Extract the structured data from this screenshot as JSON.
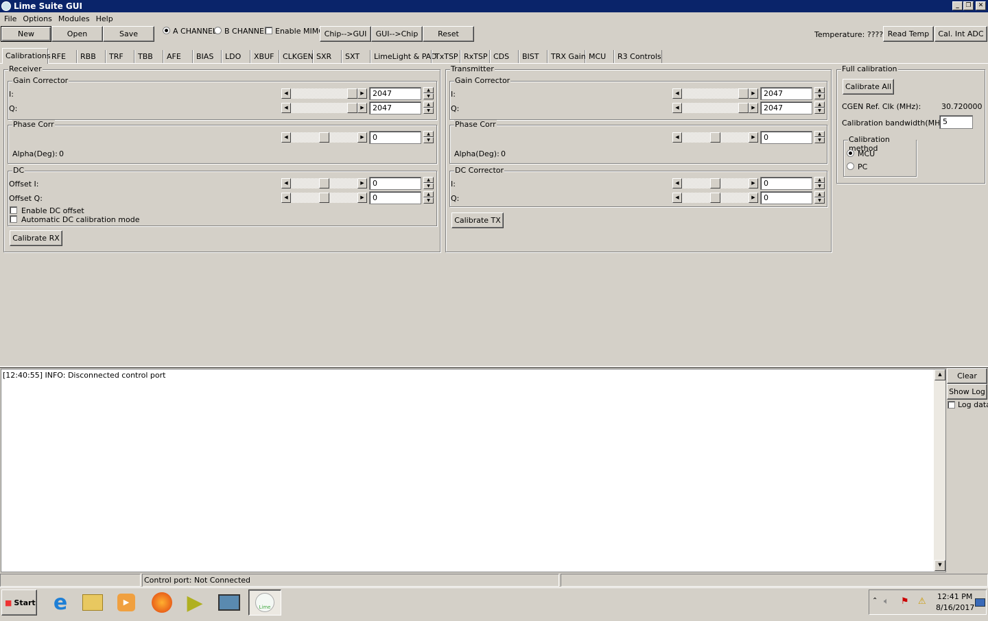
{
  "window": {
    "title": "Lime Suite GUI",
    "min": "_",
    "restore": "❐",
    "close": "✕"
  },
  "menu": [
    "File",
    "Options",
    "Modules",
    "Help"
  ],
  "toolbar": {
    "new": "New",
    "open": "Open",
    "save": "Save",
    "a_channel": "A CHANNEL",
    "b_channel": "B CHANNEL",
    "enable_mimo": "Enable MIMO",
    "chip_to_gui": "Chip-->GUI",
    "gui_to_chip": "GUI-->Chip",
    "reset": "Reset",
    "temperature": "Temperature: ?????",
    "read_temp": "Read Temp",
    "cal_int_adc": "Cal. Int ADC",
    "selected_channel": "A"
  },
  "tabs": [
    "Calibrations",
    "RFE",
    "RBB",
    "TRF",
    "TBB",
    "AFE",
    "BIAS",
    "LDO",
    "XBUF",
    "CLKGEN",
    "SXR",
    "SXT",
    "LimeLight & PAD",
    "TxTSP",
    "RxTSP",
    "CDS",
    "BIST",
    "TRX Gain",
    "MCU",
    "R3 Controls"
  ],
  "receiver": {
    "title": "Receiver",
    "gain_title": "Gain Corrector",
    "i_label": "I:",
    "q_label": "Q:",
    "gain_i": {
      "value": "2047",
      "fraction": 1.0
    },
    "gain_q": {
      "value": "2047",
      "fraction": 1.0
    },
    "phase_title": "Phase Corr",
    "phase": {
      "value": "0",
      "fraction": 0.5
    },
    "alpha_label": "Alpha(Deg):",
    "alpha_value": "0",
    "dc_title": "DC",
    "offset_i_label": "Offset I:",
    "offset_q_label": "Offset Q:",
    "offset_i": {
      "value": "0",
      "fraction": 0.5
    },
    "offset_q": {
      "value": "0",
      "fraction": 0.5
    },
    "enable_dc": "Enable DC offset",
    "auto_dc": "Automatic DC calibration mode",
    "calibrate": "Calibrate RX"
  },
  "transmitter": {
    "title": "Transmitter",
    "gain_title": "Gain Corrector",
    "i_label": "I:",
    "q_label": "Q:",
    "gain_i": {
      "value": "2047",
      "fraction": 1.0
    },
    "gain_q": {
      "value": "2047",
      "fraction": 1.0
    },
    "phase_title": "Phase Corr",
    "phase": {
      "value": "0",
      "fraction": 0.5
    },
    "alpha_label": "Alpha(Deg):",
    "alpha_value": "0",
    "dc_title": "DC Corrector",
    "dc_i": {
      "value": "0",
      "fraction": 0.5
    },
    "dc_q": {
      "value": "0",
      "fraction": 0.5
    },
    "calibrate": "Calibrate TX"
  },
  "full": {
    "title": "Full calibration",
    "calibrate_all": "Calibrate All",
    "cgen_label": "CGEN Ref. Clk (MHz):",
    "cgen_value": "30.720000",
    "bw_label": "Calibration bandwidth(MHz):",
    "bw_value": "5",
    "method_title": "Calibration method",
    "mcu": "MCU",
    "pc": "PC",
    "selected": "MCU"
  },
  "log": {
    "lines": [
      "[12:40:55] INFO: Disconnected control port"
    ],
    "clear": "Clear",
    "show_log": "Show Log",
    "log_data": "Log data"
  },
  "status": {
    "control_port": "Control port: Not Connected"
  },
  "taskbar": {
    "start": "Start",
    "time": "12:41 PM",
    "date": "8/16/2017",
    "lime_label": "Lime"
  }
}
